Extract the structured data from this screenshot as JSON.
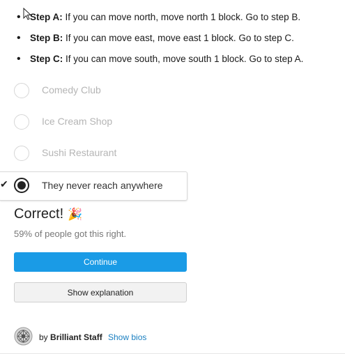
{
  "steps": [
    {
      "bullet": "•",
      "name": "Step A:",
      "text": " If you can move north, move north 1 block. Go to step B."
    },
    {
      "bullet": "•",
      "name": "Step B:",
      "text": " If you can move east, move east 1 block. Go to step C."
    },
    {
      "bullet": "•",
      "name": "Step C:",
      "text": " If you can move south, move south 1 block. Go to step A."
    }
  ],
  "choices": [
    {
      "label": "Comedy Club"
    },
    {
      "label": "Ice Cream Shop"
    },
    {
      "label": "Sushi Restaurant"
    },
    {
      "label": "They never reach anywhere",
      "selected": true
    }
  ],
  "result": {
    "title": "Correct!",
    "emoji": "🎉",
    "stat": "59% of people got this right."
  },
  "buttons": {
    "continue": "Continue",
    "explanation": "Show explanation"
  },
  "author": {
    "by": "by",
    "name": "Brilliant Staff",
    "bios": "Show bios"
  },
  "icons": {
    "check": "✔",
    "avatar": "brilliant-staff-avatar-icon",
    "cursor": "mouse-pointer-icon"
  },
  "colors": {
    "accent": "#1a9be6",
    "link": "#1a7fc1"
  }
}
